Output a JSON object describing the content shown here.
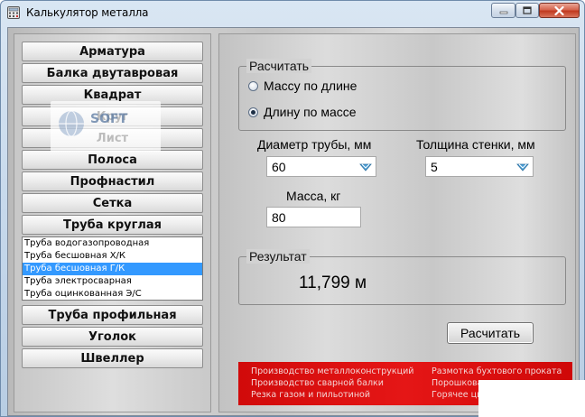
{
  "window": {
    "title": "Калькулятор металла"
  },
  "watermark": {
    "text": "SOFT"
  },
  "categories": [
    "Арматура",
    "Балка двутавровая",
    "Квадрат",
    "Круг",
    "Лист",
    "Полоса",
    "Профнастил",
    "Сетка",
    "Труба круглая",
    "Труба профильная",
    "Уголок",
    "Швеллер"
  ],
  "pipe_types": {
    "items": [
      "Труба водогазопроводная",
      "Труба бесшовная Х/К",
      "Труба бесшовная Г/К",
      "Труба электросварная",
      "Труба оцинкованная Э/С"
    ],
    "selected_index": 2
  },
  "calc_mode": {
    "legend": "Расчитать",
    "options": [
      "Массу по длине",
      "Длину по массе"
    ],
    "selected_index": 1
  },
  "inputs": {
    "diameter_label": "Диаметр трубы, мм",
    "diameter_value": "60",
    "wall_label": "Толщина стенки, мм",
    "wall_value": "5",
    "mass_label": "Масса, кг",
    "mass_value": "80"
  },
  "result": {
    "legend": "Результат",
    "value": "11,799 м"
  },
  "calc_button_label": "Расчитать",
  "ad": {
    "left_lines": [
      "Производство металлоконструкций",
      "Производство сварной балки",
      "Резка газом и пильотиной"
    ],
    "right_lines": [
      "Размотка бухтового проката",
      "Порошковая покраска",
      "Горячее цинкование"
    ]
  },
  "colors": {
    "selection": "#3399ff",
    "ad_background": "#e51616",
    "close_button": "#c13a20"
  }
}
